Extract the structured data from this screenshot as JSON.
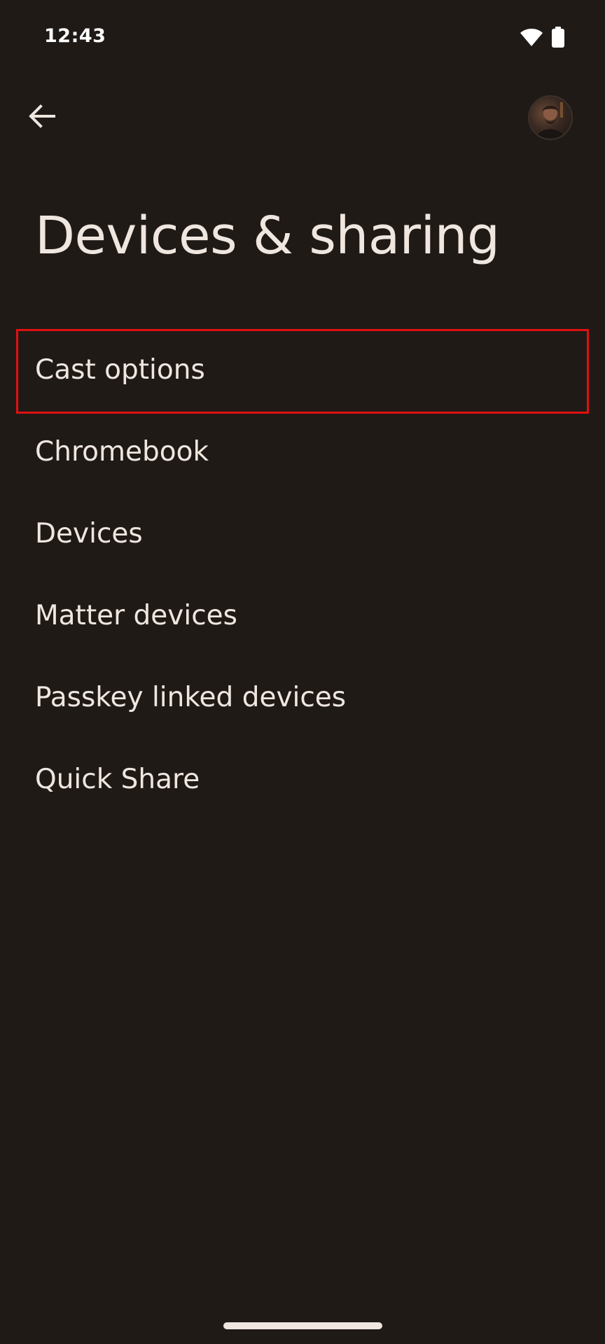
{
  "status_bar": {
    "time": "12:43",
    "icons": [
      "wifi-icon",
      "battery-icon"
    ]
  },
  "top_bar": {
    "back_icon": "arrow-back-icon",
    "avatar": "account-avatar"
  },
  "page": {
    "title": "Devices & sharing"
  },
  "menu": {
    "items": [
      {
        "label": "Cast options",
        "highlighted": true
      },
      {
        "label": "Chromebook"
      },
      {
        "label": "Devices"
      },
      {
        "label": "Matter devices"
      },
      {
        "label": "Passkey linked devices"
      },
      {
        "label": "Quick Share"
      }
    ]
  },
  "colors": {
    "background": "#201a17",
    "text": "#efe6df",
    "highlight_border": "#e01010"
  }
}
